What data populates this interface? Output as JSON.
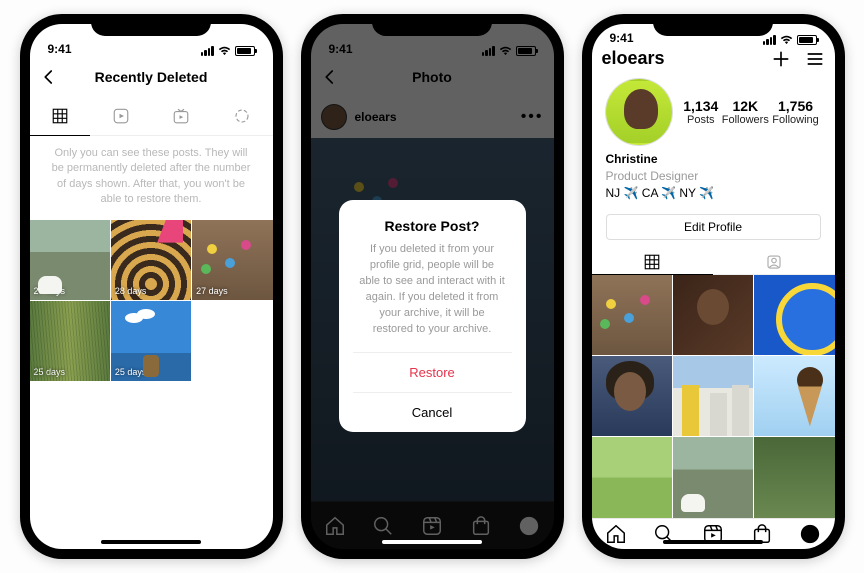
{
  "status": {
    "time": "9:41"
  },
  "screen1": {
    "title": "Recently Deleted",
    "info": "Only you can see these posts. They will be permanently deleted after the number of days shown. After that, you won't be able to restore them.",
    "posts": [
      {
        "badge": "29 days"
      },
      {
        "badge": "28 days"
      },
      {
        "badge": "27 days"
      },
      {
        "badge": "25 days"
      },
      {
        "badge": "25 days"
      }
    ]
  },
  "screen2": {
    "title": "Photo",
    "username": "eloears",
    "modal": {
      "title": "Restore Post?",
      "body": "If you deleted it from your profile grid, people will be able to see and interact with it again. If you deleted it from your archive, it will be restored to your archive.",
      "restore": "Restore",
      "cancel": "Cancel"
    }
  },
  "screen3": {
    "username": "eloears",
    "stats": {
      "posts_val": "1,134",
      "posts_lbl": "Posts",
      "followers_val": "12K",
      "followers_lbl": "Followers",
      "following_val": "1,756",
      "following_lbl": "Following"
    },
    "bio": {
      "name": "Christine",
      "role": "Product Designer",
      "location": "NJ ✈️ CA ✈️ NY ✈️"
    },
    "edit": "Edit Profile"
  }
}
